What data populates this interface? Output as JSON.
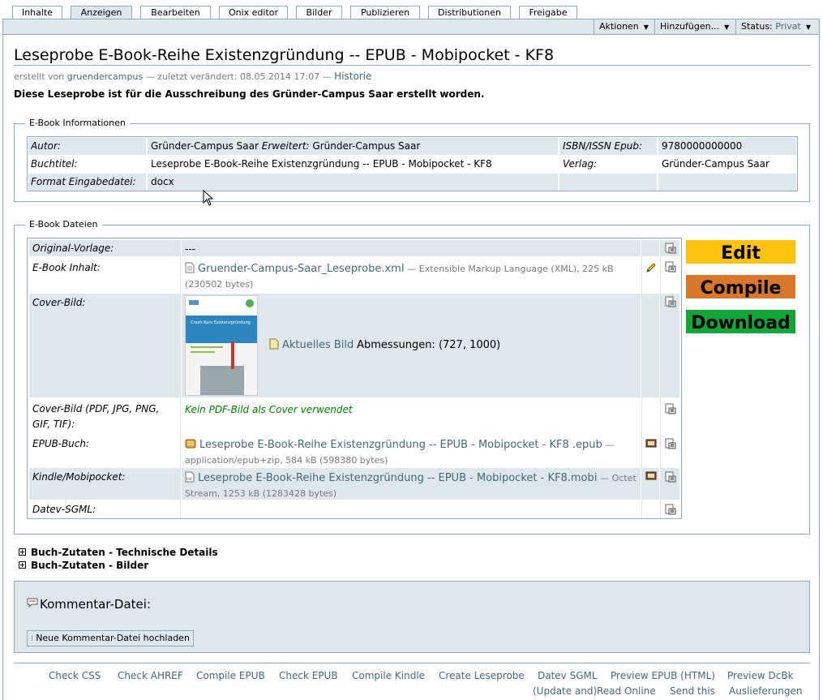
{
  "tabs": [
    "Inhalte",
    "Anzeigen",
    "Bearbeiten",
    "Onix editor",
    "Bilder",
    "Publizieren",
    "Distributionen",
    "Freigabe"
  ],
  "actions": {
    "aktionen": "Aktionen",
    "hinzufuegen": "Hinzufügen...",
    "status_label": "Status:",
    "status_value": "Privat"
  },
  "page": {
    "title": "Leseprobe E-Book-Reihe Existenzgründung -- EPUB - Mobipocket - KF8",
    "byline_prefix": "erstellt von",
    "author": "gruendercampus",
    "byline_mid": "— zuletzt verändert: 08.05.2014 17:07 —",
    "history": "Historie",
    "description": "Diese Leseprobe ist für die Ausschreibung des Gründer-Campus Saar erstellt worden."
  },
  "info": {
    "legend": "E-Book Informationen",
    "autor_label": "Autor:",
    "autor_value": "Gründer-Campus Saar",
    "erweitert_label": "Erweitert:",
    "erweitert_value": "Gründer-Campus Saar",
    "isbn_label": "ISBN/ISSN Epub:",
    "isbn_value": "9780000000000",
    "buchtitel_label": "Buchtitel:",
    "buchtitel_value": "Leseprobe E-Book-Reihe Existenzgründung -- EPUB - Mobipocket - KF8",
    "verlag_label": "Verlag:",
    "verlag_value": "Gründer-Campus Saar",
    "format_label": "Format Eingabedatei:",
    "format_value": "docx"
  },
  "files": {
    "legend": "E-Book Dateien",
    "original_label": "Original-Vorlage:",
    "original_value": "---",
    "inhalt_label": "E-Book Inhalt:",
    "inhalt_link": "Gruender-Campus-Saar_Leseprobe.xml",
    "inhalt_meta": "— Extensible Markup Language (XML), 225 kB",
    "inhalt_bytes": "(230502 bytes)",
    "cover_label": "Cover-Bild:",
    "cover_link": "Aktuelles Bild",
    "cover_dims": "Abmessungen: (727, 1000)",
    "cover_thumb_title": "Crash-Kurs Existenzgründung",
    "coverpdf_label_1": "Cover-Bild (PDF, JPG, PNG,",
    "coverpdf_label_2": "GIF, TIF):",
    "coverpdf_value": "Kein PDF-Bild als Cover verwendet",
    "epub_label": "EPUB-Buch:",
    "epub_link": "Leseprobe E-Book-Reihe Existenzgründung -- EPUB - Mobipocket - KF8 .epub",
    "epub_meta_1": "—",
    "epub_meta_2": "application/epub+zip, 584 kB (598380 bytes)",
    "kindle_label": "Kindle/Mobipocket:",
    "kindle_link": "Leseprobe E-Book-Reihe Existenzgründung -- EPUB - Mobipocket - KF8.mobi",
    "kindle_meta_1": "— Octet",
    "kindle_meta_2": "Stream, 1253 kB (1283428 bytes)",
    "datev_label": "Datev-SGML:"
  },
  "buttons": {
    "edit": "Edit",
    "compile": "Compile",
    "download": "Download"
  },
  "colors": {
    "edit_bg": "#ffc20e",
    "compile_bg": "#d9782c",
    "download_bg": "#13a538",
    "accent": "#436976",
    "border": "#8cacbb",
    "shade": "#dee7ec"
  },
  "sections": {
    "technische_details": "Buch-Zutaten - Technische Details",
    "bilder": "Buch-Zutaten - Bilder"
  },
  "kommentar": {
    "title": "Kommentar-Datei:",
    "upload": "Neue Kommentar-Datei hochladen"
  },
  "footer": {
    "check_css": "Check CSS",
    "check_ahref": "Check AHREF",
    "compile_epub": "Compile EPUB",
    "check_epub": "Check EPUB",
    "compile_kindle": "Compile Kindle",
    "create_leseprobe": "Create Leseprobe",
    "datev_sgml_1": "Datev SGML",
    "datev_sgml_2": "(Update and)",
    "preview_epub_1": "Preview EPUB (HTML)",
    "preview_epub_2": "Read Online",
    "send_this": "Send this",
    "preview_dcbk_1": "Preview DcBk",
    "preview_dcbk_2": "Auslieferungen"
  }
}
